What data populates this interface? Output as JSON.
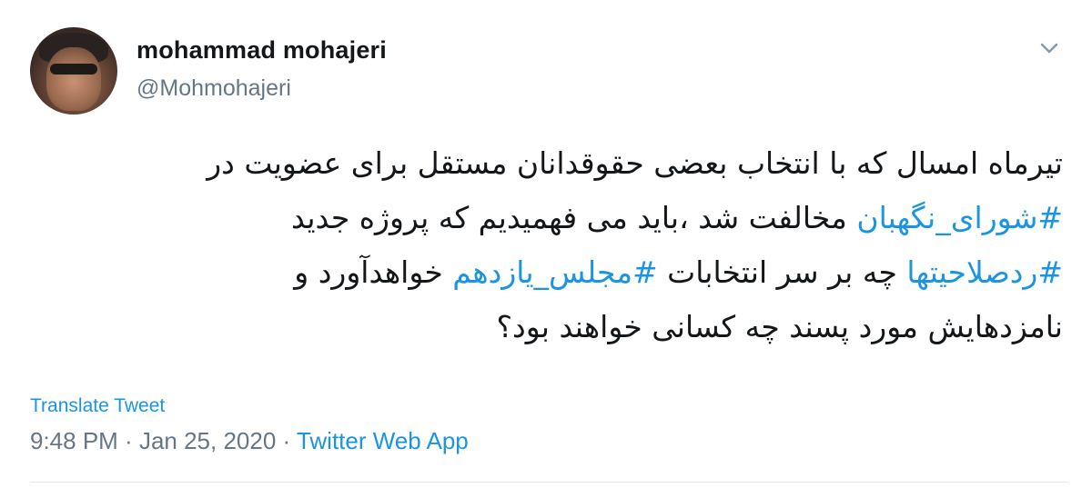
{
  "user": {
    "display_name": "mohammad mohajeri",
    "handle": "@Mohmohajeri",
    "avatar_icon": "profile-photo"
  },
  "menu": {
    "icon": "chevron-down-icon"
  },
  "tweet": {
    "line1": "تیرماه امسال که با انتخاب بعضی حقوقدانان مستقل برای عضویت در",
    "line2_hashtag": "#شورای_نگهبان",
    "line2_text": " مخالفت شد ،باید می فهمیدیم که پروژه جدید",
    "line3_hashtag1": "#ردصلاحیتها",
    "line3_text1": " چه بر سر انتخابات ",
    "line3_hashtag2": "#مجلس_یازدهم",
    "line3_text2": " خواهدآورد و",
    "line4": "نامزدهایش مورد پسند چه کسانی خواهند بود؟"
  },
  "translate_label": "Translate Tweet",
  "meta": {
    "time": "9:48 PM",
    "separator1": " · ",
    "date": "Jan 25, 2020",
    "separator2": " · ",
    "source": "Twitter Web App"
  },
  "colors": {
    "link": "#1b95e0",
    "secondary": "#657786",
    "text": "#14171a"
  }
}
